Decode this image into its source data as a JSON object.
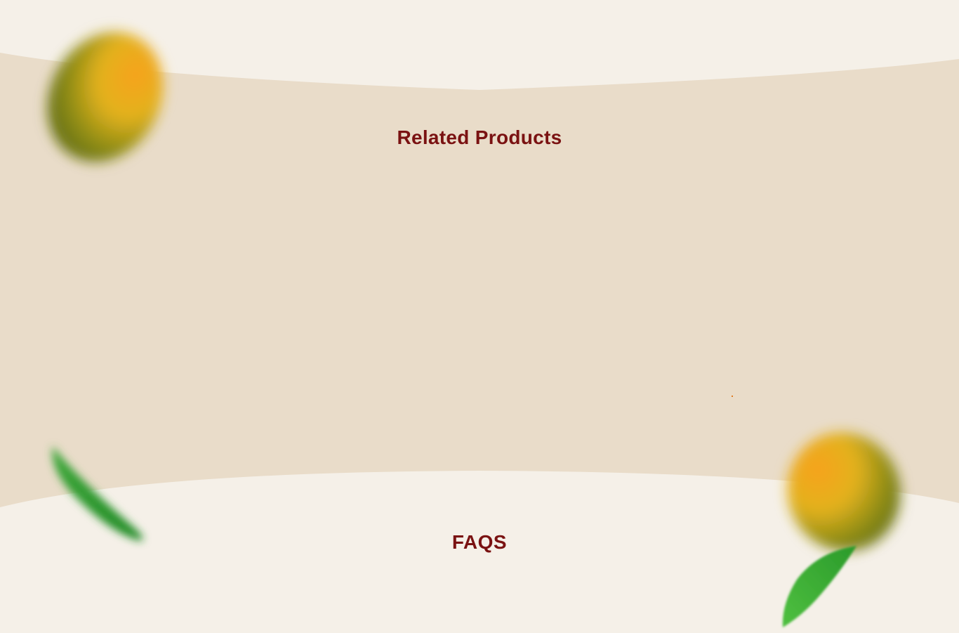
{
  "related_products": {
    "title": "Related Products"
  },
  "faqs": {
    "title": "FAQS"
  },
  "colors": {
    "page_background": "#f5f0e8",
    "band_background": "#e9dcc9",
    "heading": "#7a1212"
  },
  "decorations": {
    "top_left": "mango-icon",
    "bottom_left": "leaf-icon",
    "bottom_right": "mango-with-leaf-icon"
  }
}
